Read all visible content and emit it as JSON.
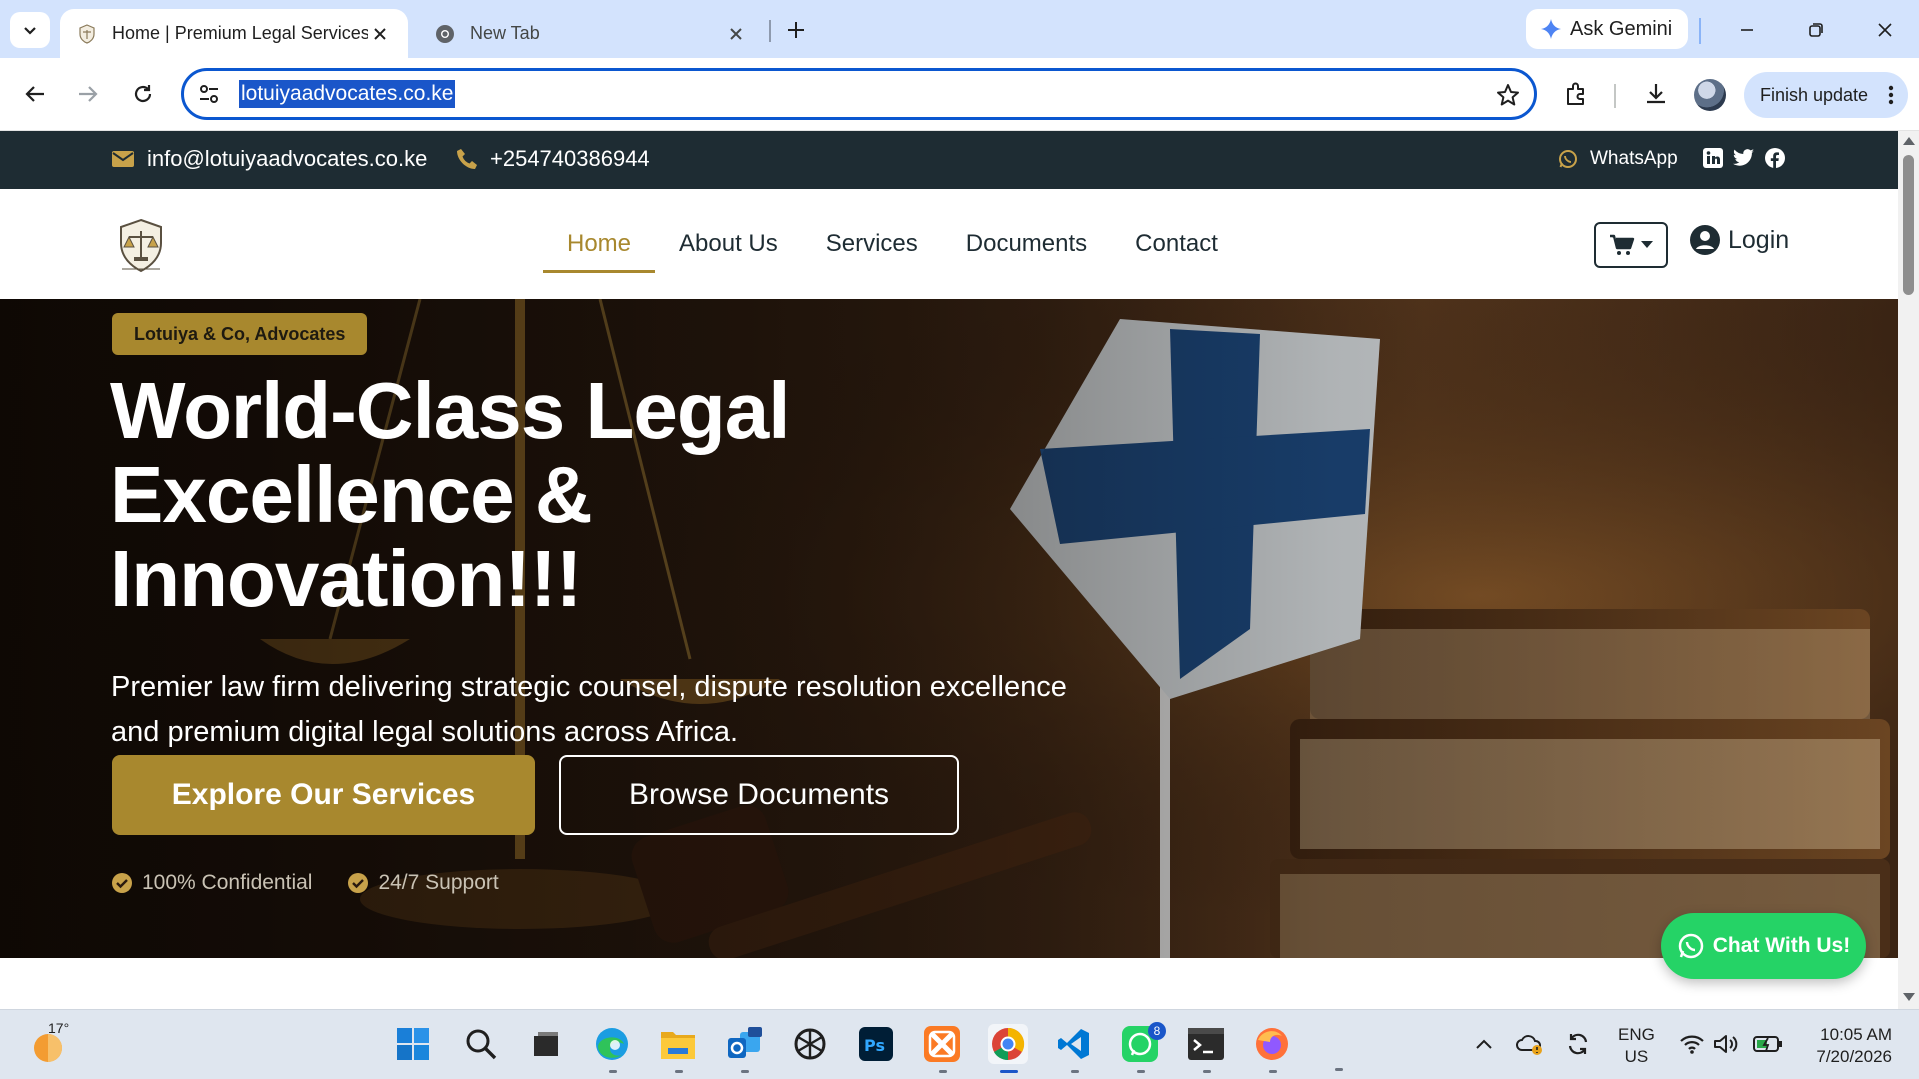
{
  "browser": {
    "tabs": [
      {
        "title": "Home | Premium Legal Services",
        "active": true
      },
      {
        "title": "New Tab",
        "active": false
      }
    ],
    "gemini_label": "Ask Gemini",
    "url": "lotuiyaadvocates.co.ke",
    "finish_update_label": "Finish update"
  },
  "site": {
    "topbar": {
      "email": "info@lotuiyaadvocates.co.ke",
      "phone": "+254740386944",
      "whatsapp_label": "WhatsApp"
    },
    "nav": {
      "items": [
        "Home",
        "About Us",
        "Services",
        "Documents",
        "Contact"
      ],
      "active_index": 0,
      "login_label": "Login"
    },
    "hero": {
      "badge": "Lotuiya & Co, Advocates",
      "title": "World-Class Legal Excellence & Innovation!!!",
      "subtitle": "Premier law firm delivering strategic counsel, dispute resolution excellence and premium digital legal solutions across Africa.",
      "primary_button": "Explore Our Services",
      "secondary_button": "Browse Documents",
      "features": [
        "100% Confidential",
        "24/7 Support"
      ]
    },
    "chat_button": "Chat With Us!",
    "colors": {
      "accent": "#a8882e",
      "dark": "#1e2c33",
      "whatsapp": "#25d366"
    }
  },
  "taskbar": {
    "weather_temp": "17°",
    "language_line1": "ENG",
    "language_line2": "US",
    "time": "10:05 AM",
    "date": "7/20/2026",
    "whatsapp_badge": "8",
    "apps": [
      "start-icon",
      "search-icon",
      "task-view-icon",
      "edge-icon",
      "file-explorer-icon",
      "outlook-icon",
      "chatgpt-icon",
      "photoshop-icon",
      "xampp-icon",
      "chrome-icon",
      "vscode-icon",
      "whatsapp-icon",
      "terminal-icon",
      "firefox-icon"
    ]
  }
}
